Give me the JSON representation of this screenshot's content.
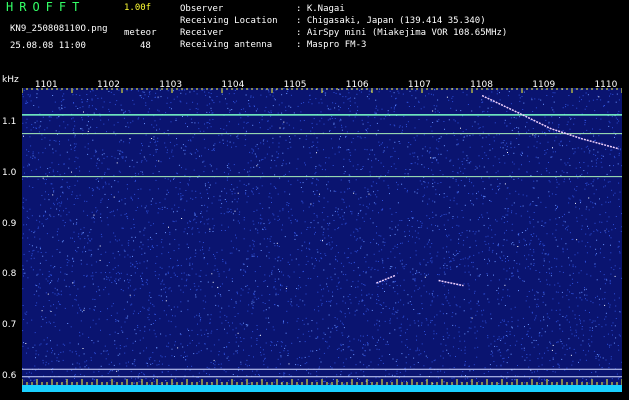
{
  "header": {
    "app_title": "HROFFT",
    "version": "1.00f",
    "filename": "KN9_250808110O.png",
    "mode": "meteor",
    "datetime": "25.08.08 11:00",
    "count": "48",
    "fields": [
      {
        "label": "Observer",
        "value": ": K.Nagai"
      },
      {
        "label": "Receiving Location",
        "value": ": Chigasaki, Japan (139.414 35.340)"
      },
      {
        "label": "Receiver",
        "value": ": AirSpy mini (Miakejima VOR 108.65MHz)"
      },
      {
        "label": "Receiving antenna",
        "value": ": Maspro FM-3"
      }
    ]
  },
  "chart_data": {
    "type": "heatmap",
    "ylabel": "kHz",
    "y_ticks": [
      "1.1",
      "1.0",
      "0.9",
      "0.8",
      "0.7",
      "0.6"
    ],
    "y_tick_values": [
      1.1,
      1.0,
      0.9,
      0.8,
      0.7,
      0.6
    ],
    "ylim": [
      0.57,
      1.17
    ],
    "x_ticks": [
      "1101",
      "1102",
      "1103",
      "1104",
      "1105",
      "1106",
      "1107",
      "1108",
      "1109",
      "1110"
    ],
    "x_tick_values": [
      1101,
      1102,
      1103,
      1104,
      1105,
      1106,
      1107,
      1108,
      1109,
      1110
    ],
    "xlim": [
      1100.6,
      1110.25
    ],
    "colors": {
      "background": "#0a1470",
      "noise": "#3a6cff",
      "carrier": "#b8f0c8",
      "meteor": "#ffffff",
      "tick": "#ffff33"
    },
    "horizontal_lines_khz": [
      1.117,
      1.08,
      0.995,
      0.615,
      0.6
    ],
    "echoes": [
      {
        "x": [
          1108.0,
          1108.6,
          1109.1,
          1109.6,
          1110.2
        ],
        "y": [
          1.155,
          1.12,
          1.09,
          1.07,
          1.05
        ]
      },
      {
        "x": [
          1107.3,
          1107.7
        ],
        "y": [
          0.79,
          0.78
        ]
      },
      {
        "x": [
          1106.3,
          1106.6
        ],
        "y": [
          0.785,
          0.8
        ]
      }
    ]
  }
}
